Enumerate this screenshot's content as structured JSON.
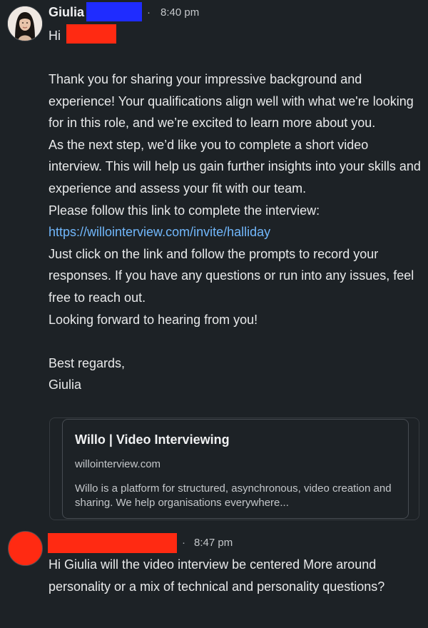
{
  "message1": {
    "sender_name": "Giulia",
    "time": "8:40 pm",
    "separator": "·",
    "greeting": "Hi",
    "paragraphs": [
      "Thank you for sharing your impressive background and experience! Your qualifications align well with what we're looking for in this role, and we’re excited to learn more about you.",
      "As the next step, we’d like you to complete a short video interview. This will help us gain further insights into your skills and experience and assess your fit with our team."
    ],
    "link_intro": "Please follow this link to complete the interview:",
    "link_text": "https://willointerview.com/invite/halliday",
    "paragraphs_after": [
      "Just click on the link and follow the prompts to record your responses. If you have any questions or run into any issues, feel free to reach out.",
      "Looking forward to hearing from you!"
    ],
    "signoff": "Best regards,",
    "signature": "Giulia"
  },
  "link_preview": {
    "title": "Willo | Video Interviewing",
    "domain": "willointerview.com",
    "description": "Willo is a platform for structured, asynchronous, video creation and sharing. We help organisations everywhere..."
  },
  "message2": {
    "time": "8:47 pm",
    "separator": "·",
    "text": "Hi Giulia will the video interview be centered More around personality or a mix of technical and personality questions?"
  },
  "colors": {
    "background": "#1d2226",
    "text": "#e8e9ea",
    "link": "#71b7fb",
    "redaction_red": "#ff2a12",
    "redaction_blue": "#1f2cff"
  }
}
